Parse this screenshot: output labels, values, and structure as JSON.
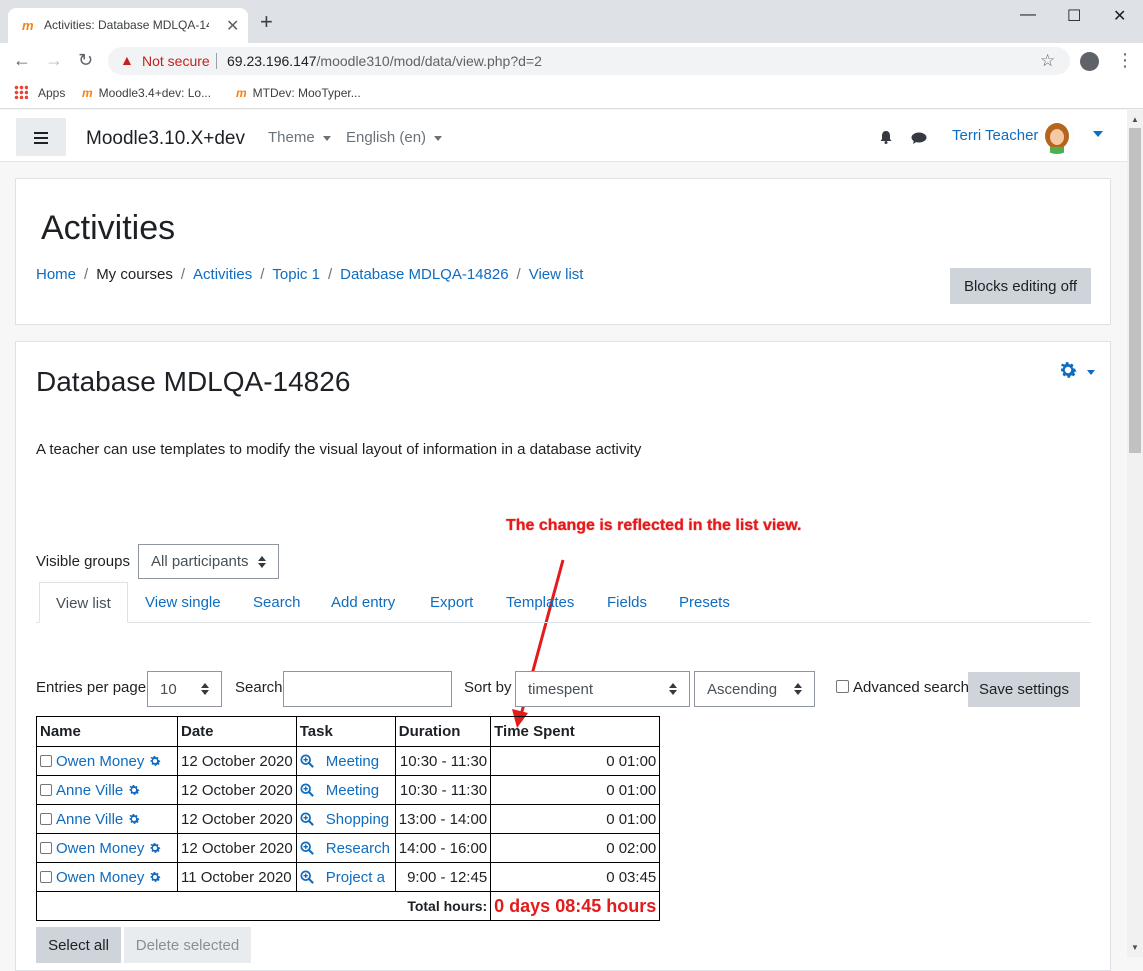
{
  "browser": {
    "tab_title": "Activities: Database MDLQA-148...",
    "new_tab": "+",
    "security_label": "Not secure",
    "url_host": "69.23.196.147",
    "url_path": "/moodle310/mod/data/view.php?d=2",
    "bookmarks": [
      "Apps",
      "Moodle3.4+dev: Lo...",
      "MTDev: MooTyper..."
    ]
  },
  "navbar": {
    "brand": "Moodle3.10.X+dev",
    "theme": "Theme",
    "language": "English (en)",
    "user": "Terri Teacher"
  },
  "header": {
    "title": "Activities",
    "breadcrumb": [
      "Home",
      "My courses",
      "Activities",
      "Topic 1",
      "Database MDLQA-14826",
      "View list"
    ],
    "blocks_button": "Blocks editing off"
  },
  "main": {
    "title": "Database MDLQA-14826",
    "intro": "A teacher can use templates to modify the visual layout of information in a database activity",
    "annotation": "The change is reflected in the list view.",
    "visible_groups_label": "Visible groups",
    "visible_groups_value": "All participants",
    "tabs": [
      "View list",
      "View single",
      "Search",
      "Add entry",
      "Export",
      "Templates",
      "Fields",
      "Presets"
    ],
    "controls": {
      "entries_label": "Entries per page",
      "entries_value": "10",
      "search_label": "Search",
      "sort_label": "Sort by",
      "sort_value": "timespent",
      "order_value": "Ascending",
      "advanced_label": "Advanced search",
      "save_button": "Save settings"
    },
    "table": {
      "headers": [
        "Name",
        "Date",
        "Task",
        "Duration",
        "Time Spent"
      ],
      "rows": [
        {
          "name": "Owen Money",
          "date": "12 October 2020",
          "task": "Meeting",
          "duration": "10:30 - 11:30",
          "spent": "0 01:00"
        },
        {
          "name": "Anne Ville",
          "date": "12 October 2020",
          "task": "Meeting",
          "duration": "10:30 - 11:30",
          "spent": "0 01:00"
        },
        {
          "name": "Anne Ville",
          "date": "12 October 2020",
          "task": "Shopping",
          "duration": "13:00 - 14:00",
          "spent": "0 01:00"
        },
        {
          "name": "Owen Money",
          "date": "12 October 2020",
          "task": "Research",
          "duration": "14:00 - 16:00",
          "spent": "0 02:00"
        },
        {
          "name": "Owen Money",
          "date": "11 October 2020",
          "task": "Project a",
          "duration": "9:00 - 12:45",
          "spent": "0 03:45"
        }
      ],
      "total_label": "Total hours:",
      "total_value": "0 days 08:45 hours"
    },
    "select_all": "Select all",
    "delete_selected": "Delete selected"
  },
  "colors": {
    "link": "#0f6cbf",
    "annotation": "#e31b1b",
    "button_gray": "#ced4da"
  }
}
